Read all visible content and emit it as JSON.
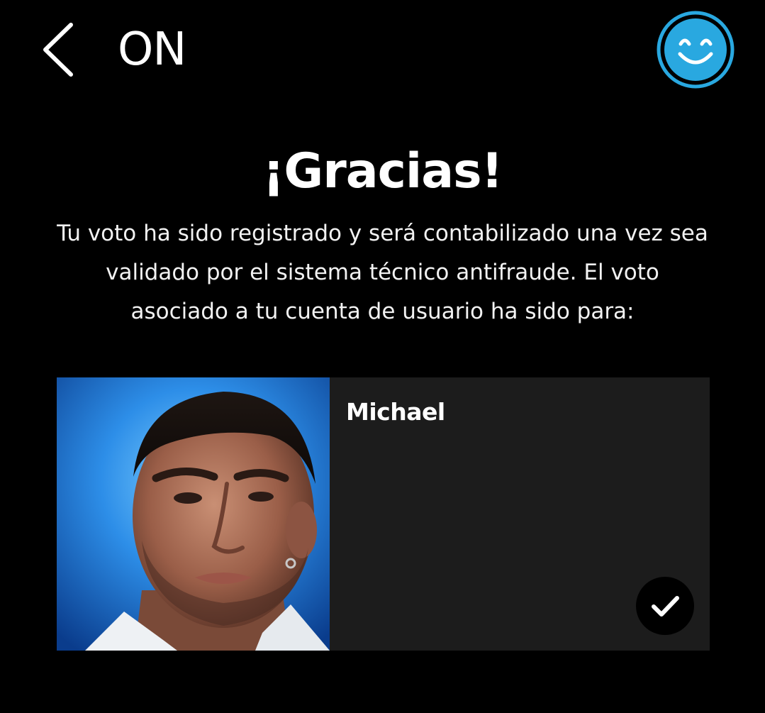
{
  "header": {
    "brand": "ON",
    "back_icon": "chevron-left-icon",
    "profile_icon": "smiley-face-icon",
    "accent_color": "#29a8e0"
  },
  "main": {
    "title": "¡Gracias!",
    "message_lines": [
      "Tu voto ha sido registrado y será contabilizado una vez sea",
      "validado por el sistema técnico antifraude. El voto",
      "asociado a tu cuenta de usuario ha sido para:"
    ]
  },
  "candidate": {
    "name": "Michael",
    "status_icon": "checkmark-icon",
    "selected": true
  }
}
